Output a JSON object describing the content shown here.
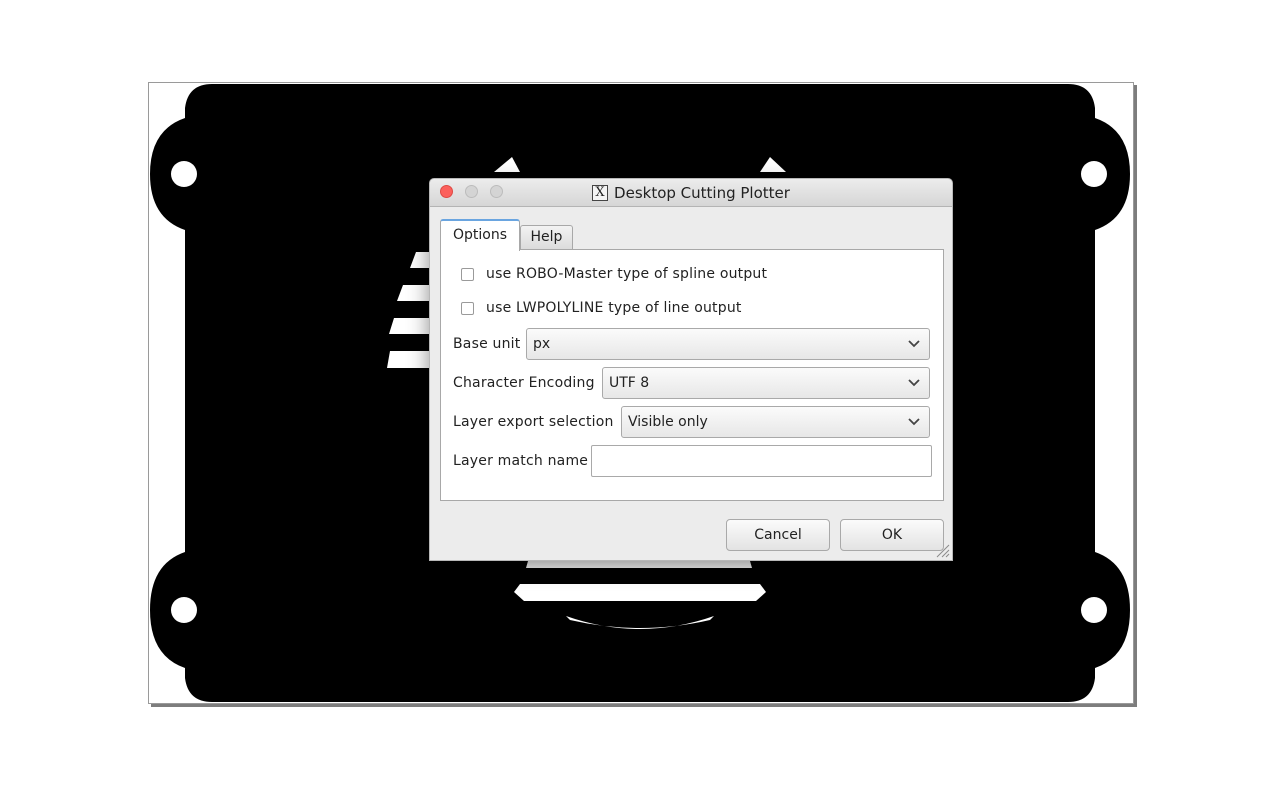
{
  "dialog": {
    "title": "Desktop Cutting Plotter",
    "tabs": [
      {
        "label": "Options",
        "active": true
      },
      {
        "label": "Help",
        "active": false
      }
    ],
    "options": {
      "robo_master_label": "use ROBO-Master type of spline output",
      "robo_master_checked": false,
      "lwpolyline_label": "use LWPOLYLINE type of line output",
      "lwpolyline_checked": false,
      "base_unit": {
        "label": "Base unit",
        "value": "px"
      },
      "character_encoding": {
        "label": "Character Encoding",
        "value": "UTF 8"
      },
      "layer_export_selection": {
        "label": "Layer export selection",
        "value": "Visible only"
      },
      "layer_match_name": {
        "label": "Layer match name",
        "value": ""
      }
    },
    "buttons": {
      "cancel": "Cancel",
      "ok": "OK"
    }
  },
  "icons": {
    "title_icon": "x11-icon",
    "dropdown": "chevron-down-icon",
    "resize": "resize-grip-icon"
  },
  "colors": {
    "artwork": "#000000",
    "close_button": "#fc605c",
    "active_tab_accent": "#6aa5e0"
  }
}
